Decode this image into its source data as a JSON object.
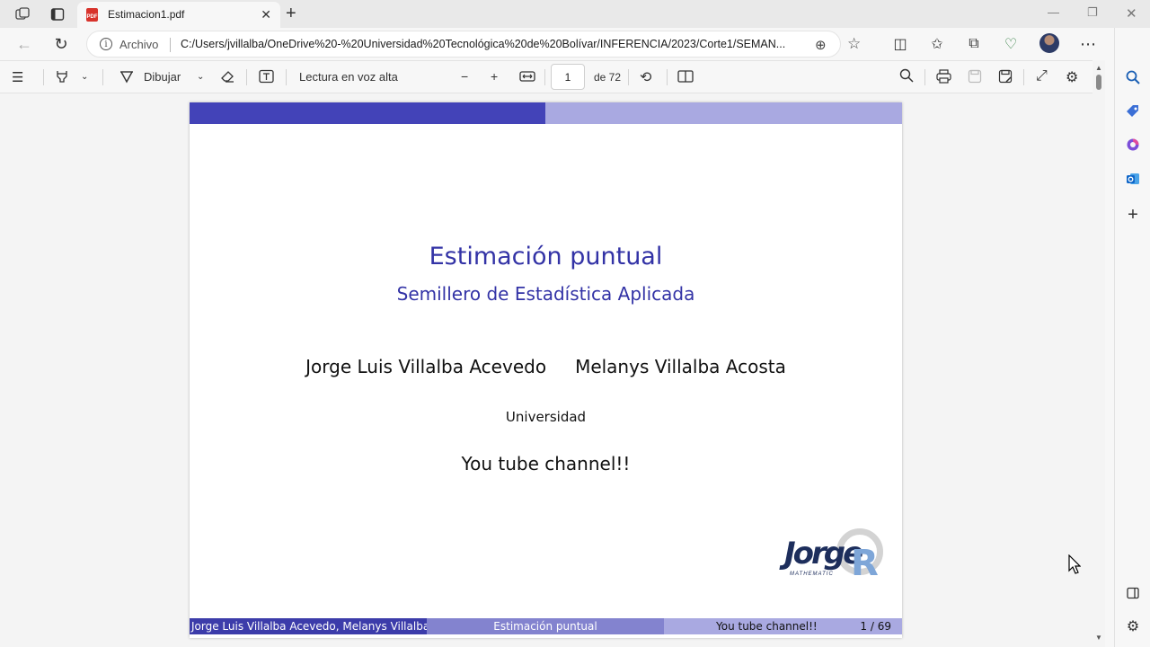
{
  "browser": {
    "tab": {
      "icon": "pdf-icon",
      "title": "Estimacion1.pdf"
    },
    "address": {
      "protocol_label": "Archivo",
      "url": "C:/Users/jvillalba/OneDrive%20-%20Universidad%20Tecnológica%20de%20Bolívar/INFERENCIA/2023/Corte1/SEMAN..."
    }
  },
  "pdf_toolbar": {
    "draw_label": "Dibujar",
    "read_aloud_label": "Lectura en voz alta",
    "current_page": "1",
    "page_total": "de 72"
  },
  "slide": {
    "title": "Estimación puntual",
    "subtitle": "Semillero de Estadística Aplicada",
    "author1": "Jorge Luis Villalba Acevedo",
    "author2": "Melanys Villalba Acosta",
    "institution": "Universidad",
    "date": "You tube channel!!",
    "footer": {
      "authors": "Jorge Luis Villalba Acevedo, Melanys Villalba Acosta",
      "title": "Estimación puntual",
      "date": "You tube channel!!",
      "page": "1 / 69"
    },
    "colors": {
      "dark": "#4343b8",
      "mid": "#8383cf",
      "light": "#a9a9e1",
      "title": "#3333a6"
    }
  }
}
